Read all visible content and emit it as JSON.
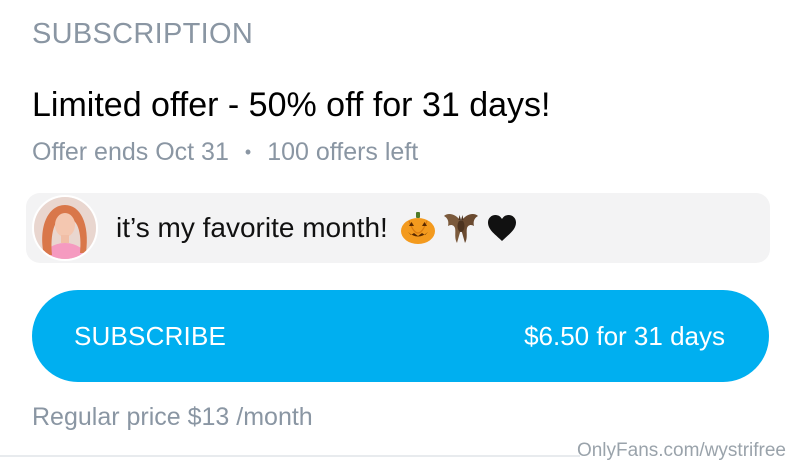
{
  "section": {
    "header": "SUBSCRIPTION"
  },
  "offer": {
    "title": "Limited offer - 50% off for 31 days!",
    "ends": "Offer ends Oct 31",
    "separator": "•",
    "remaining": "100 offers left"
  },
  "message": {
    "text": "it’s my favorite month!",
    "emojis": [
      "jack-o-lantern",
      "bat",
      "black-heart"
    ]
  },
  "subscribe": {
    "label": "SUBSCRIBE",
    "price": "$6.50 for 31 days"
  },
  "regular_price": "Regular price $13 /month",
  "watermark": "OnlyFans.com/wystrifree",
  "colors": {
    "accent": "#00aff0",
    "muted_text": "#8a96a3",
    "message_bg": "#f3f3f4"
  }
}
